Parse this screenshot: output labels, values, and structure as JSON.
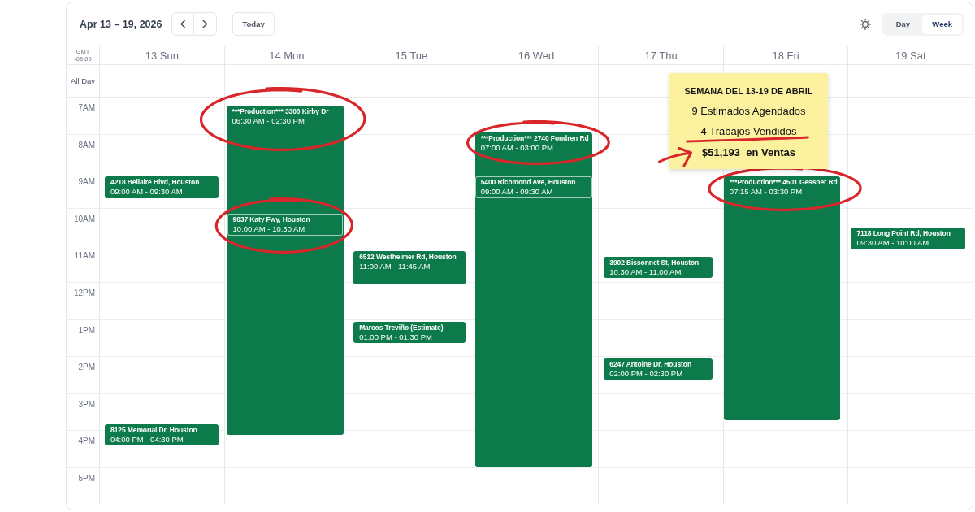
{
  "header": {
    "title": "Apr 13 – 19, 2026",
    "today_button": "Today",
    "views": [
      {
        "label": "Day",
        "selected": false
      },
      {
        "label": "Week",
        "selected": true
      }
    ]
  },
  "grid": {
    "timezone": "GMT -05:00",
    "all_day_label": "All Day",
    "hours": [
      "7AM",
      "8AM",
      "9AM",
      "10AM",
      "11AM",
      "12PM",
      "1PM",
      "2PM",
      "3PM",
      "4PM",
      "5PM"
    ],
    "days": [
      {
        "label": "13 Sun",
        "events": [
          {
            "title": "4218 Bellaire Blvd, Houston",
            "time": "09:00 AM - 09:30 AM",
            "circled": false
          },
          {
            "title": "8125 Memorial Dr, Houston",
            "time": "04:00 PM - 04:30 PM",
            "circled": false
          }
        ]
      },
      {
        "label": "14 Mon",
        "events": [
          {
            "title": "***Production*** 3300 Kirby Dr",
            "time": "06:30 AM - 02:30 PM",
            "circled": true
          },
          {
            "title": "9037 Katy Fwy, Houston",
            "time": "10:00 AM - 10:30 AM",
            "circled": true
          }
        ]
      },
      {
        "label": "15 Tue",
        "events": [
          {
            "title": "6512 Westheimer Rd, Houston",
            "time": "11:00 AM - 11:45 AM",
            "circled": false
          },
          {
            "title": "Marcos Treviño (Estimate)",
            "time": "01:00 PM - 01:30 PM",
            "circled": false
          }
        ]
      },
      {
        "label": "16 Wed",
        "events": [
          {
            "title": "***Production*** 2740 Fondren Rd",
            "time": "07:00 AM - 03:00 PM",
            "circled": true
          },
          {
            "title": "5400 Richmond Ave, Houston",
            "time": "09:00 AM - 09:30 AM",
            "circled": false
          }
        ]
      },
      {
        "label": "17 Thu",
        "events": [
          {
            "title": "3902 Bissonnet St, Houston",
            "time": "10:30 AM - 11:00 AM",
            "circled": false
          },
          {
            "title": "6247 Antoine Dr, Houston",
            "time": "02:00 PM - 02:30 PM",
            "circled": false
          }
        ]
      },
      {
        "label": "18 Fri",
        "events": [
          {
            "title": "***Production*** 4501 Gessner Rd",
            "time": "07:15 AM - 03:30 PM",
            "circled": true
          }
        ]
      },
      {
        "label": "19 Sat",
        "events": [
          {
            "title": "7118 Long Point Rd, Houston",
            "time": "09:30 AM - 10:00 AM",
            "circled": false
          }
        ]
      }
    ]
  },
  "note": {
    "heading": "SEMANA DEL 13-19 DE ABRIL",
    "lines": [
      {
        "kind": "count",
        "text": "9 Estimados Agendados",
        "underlined": false,
        "arrow": false
      },
      {
        "kind": "count",
        "text": "4 Trabajos Vendidos",
        "underlined": true,
        "arrow": false
      },
      {
        "kind": "total",
        "text": "$51,193  en Ventas",
        "underlined": false,
        "arrow": true
      }
    ]
  }
}
